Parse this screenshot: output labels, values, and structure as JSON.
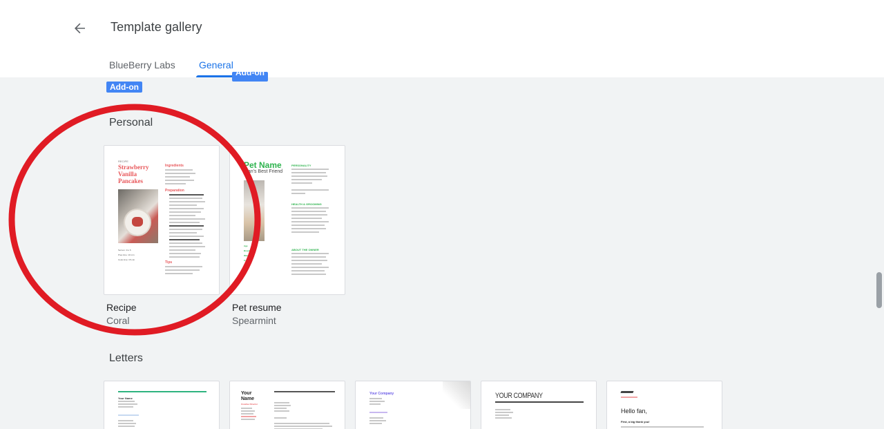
{
  "header": {
    "title": "Template gallery",
    "tabs": [
      {
        "label": "BlueBerry Labs",
        "active": false
      },
      {
        "label": "General",
        "active": true
      }
    ]
  },
  "badges": {
    "addon_1": "Add-on",
    "addon_2": "Add-on"
  },
  "sections": {
    "personal": {
      "title": "Personal",
      "templates": [
        {
          "name": "Recipe",
          "sub": "Coral",
          "preview": {
            "kicker": "RECIPE",
            "title": "Strawberry Vanilla Pancakes",
            "col_head_1": "Ingredients",
            "col_head_2": "Preparation",
            "col_head_3": "Tips",
            "meta": [
              "Serves: 4 to 6",
              "Prep time: 10 min",
              "Cook time: 15 min"
            ]
          }
        },
        {
          "name": "Pet resume",
          "sub": "Spearmint",
          "preview": {
            "title": "Pet Name",
            "subtitle": "Man's Best Friend",
            "col_head_1": "PERSONALITY",
            "col_head_2": "HEALTH & GROOMING",
            "col_head_3": "ABOUT THE OWNER",
            "side": [
              "Age",
              "Breed",
              "Weight",
              "Color"
            ]
          }
        }
      ]
    },
    "letters": {
      "title": "Letters",
      "templates": [
        {
          "preview_title": "Your Name"
        },
        {
          "preview_title": "Your Name",
          "preview_sub": "Creative Director"
        },
        {
          "preview_title": "Your Company"
        },
        {
          "preview_title": "YOUR COMPANY"
        },
        {
          "preview_title": "Hello fan,",
          "preview_sub": "First, a big thank you!"
        }
      ]
    }
  },
  "colors": {
    "accent": "#1a73e8",
    "badge": "#4285f4",
    "coral": "#e8585b",
    "spearmint": "#2eb34e",
    "annotation_circle": "#e01b24"
  }
}
